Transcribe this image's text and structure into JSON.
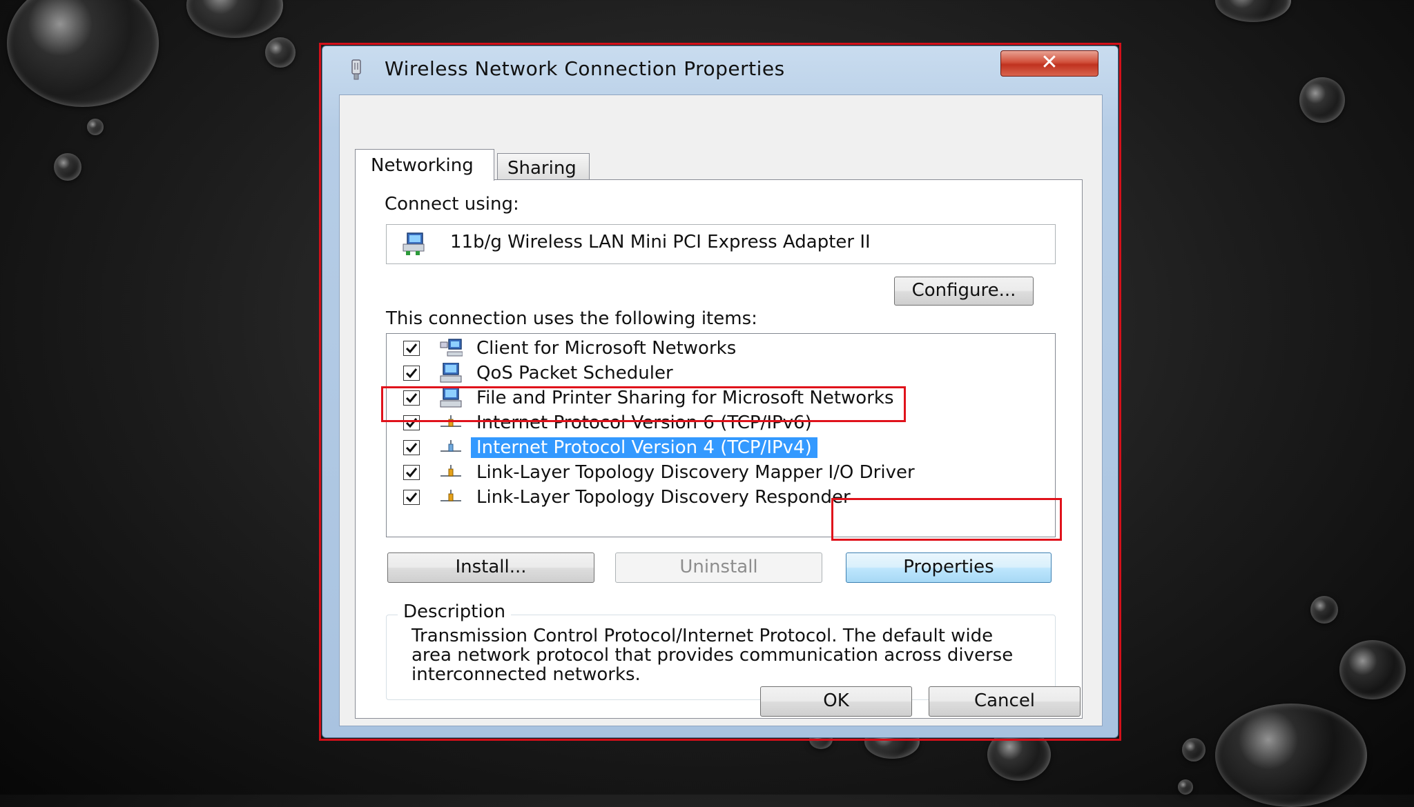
{
  "window": {
    "title": "Wireless Network Connection Properties",
    "close_glyph": "✕"
  },
  "tabs": [
    {
      "label": "Networking",
      "active": true
    },
    {
      "label": "Sharing",
      "active": false
    }
  ],
  "connect_using": {
    "label": "Connect using:",
    "adapter_name": "11b/g Wireless LAN Mini PCI Express Adapter II",
    "configure_label": "Configure..."
  },
  "items_section": {
    "label": "This connection uses the following items:",
    "items": [
      {
        "label": "Client for Microsoft Networks",
        "checked": true,
        "icon": "client-network-icon",
        "selected": false
      },
      {
        "label": "QoS Packet Scheduler",
        "checked": true,
        "icon": "computer-network-icon",
        "selected": false
      },
      {
        "label": "File and Printer Sharing for Microsoft Networks",
        "checked": true,
        "icon": "computer-network-icon",
        "selected": false
      },
      {
        "label": "Internet Protocol Version 6 (TCP/IPv6)",
        "checked": true,
        "icon": "protocol-icon",
        "selected": false
      },
      {
        "label": "Internet Protocol Version 4 (TCP/IPv4)",
        "checked": true,
        "icon": "protocol-icon",
        "selected": true
      },
      {
        "label": "Link-Layer Topology Discovery Mapper I/O Driver",
        "checked": true,
        "icon": "protocol-icon",
        "selected": false
      },
      {
        "label": "Link-Layer Topology Discovery Responder",
        "checked": true,
        "icon": "protocol-icon",
        "selected": false
      }
    ]
  },
  "buttons": {
    "install": "Install...",
    "uninstall": "Uninstall",
    "properties": "Properties",
    "ok": "OK",
    "cancel": "Cancel"
  },
  "description": {
    "legend": "Description",
    "text": "Transmission Control Protocol/Internet Protocol. The default wide area network protocol that provides communication across diverse interconnected networks."
  },
  "colors": {
    "highlight_box": "#e0121b",
    "selection": "#3399ff"
  }
}
